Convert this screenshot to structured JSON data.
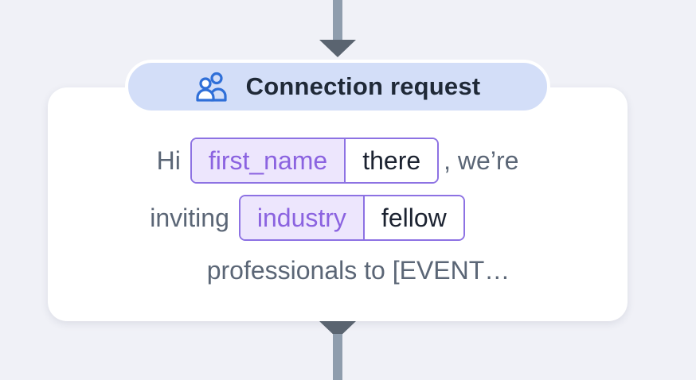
{
  "step": {
    "title": "Connection request",
    "icon": "users-icon"
  },
  "message": {
    "line1": {
      "prefix": "Hi",
      "variable": "first_name",
      "fallback": "there",
      "suffix": ", we’re"
    },
    "line2": {
      "prefix": "inviting",
      "variable": "industry",
      "fallback": "fellow"
    },
    "line3": {
      "text": "professionals to [EVENT…"
    }
  },
  "colors": {
    "background": "#f0f1f7",
    "header_bg": "#d3def8",
    "icon": "#2f6fd8",
    "variable_bg": "#ede6fd",
    "variable_text": "#8b63e0",
    "token_border": "#8d72e3",
    "connector": "#8f9dad",
    "arrow": "#5a6470"
  }
}
